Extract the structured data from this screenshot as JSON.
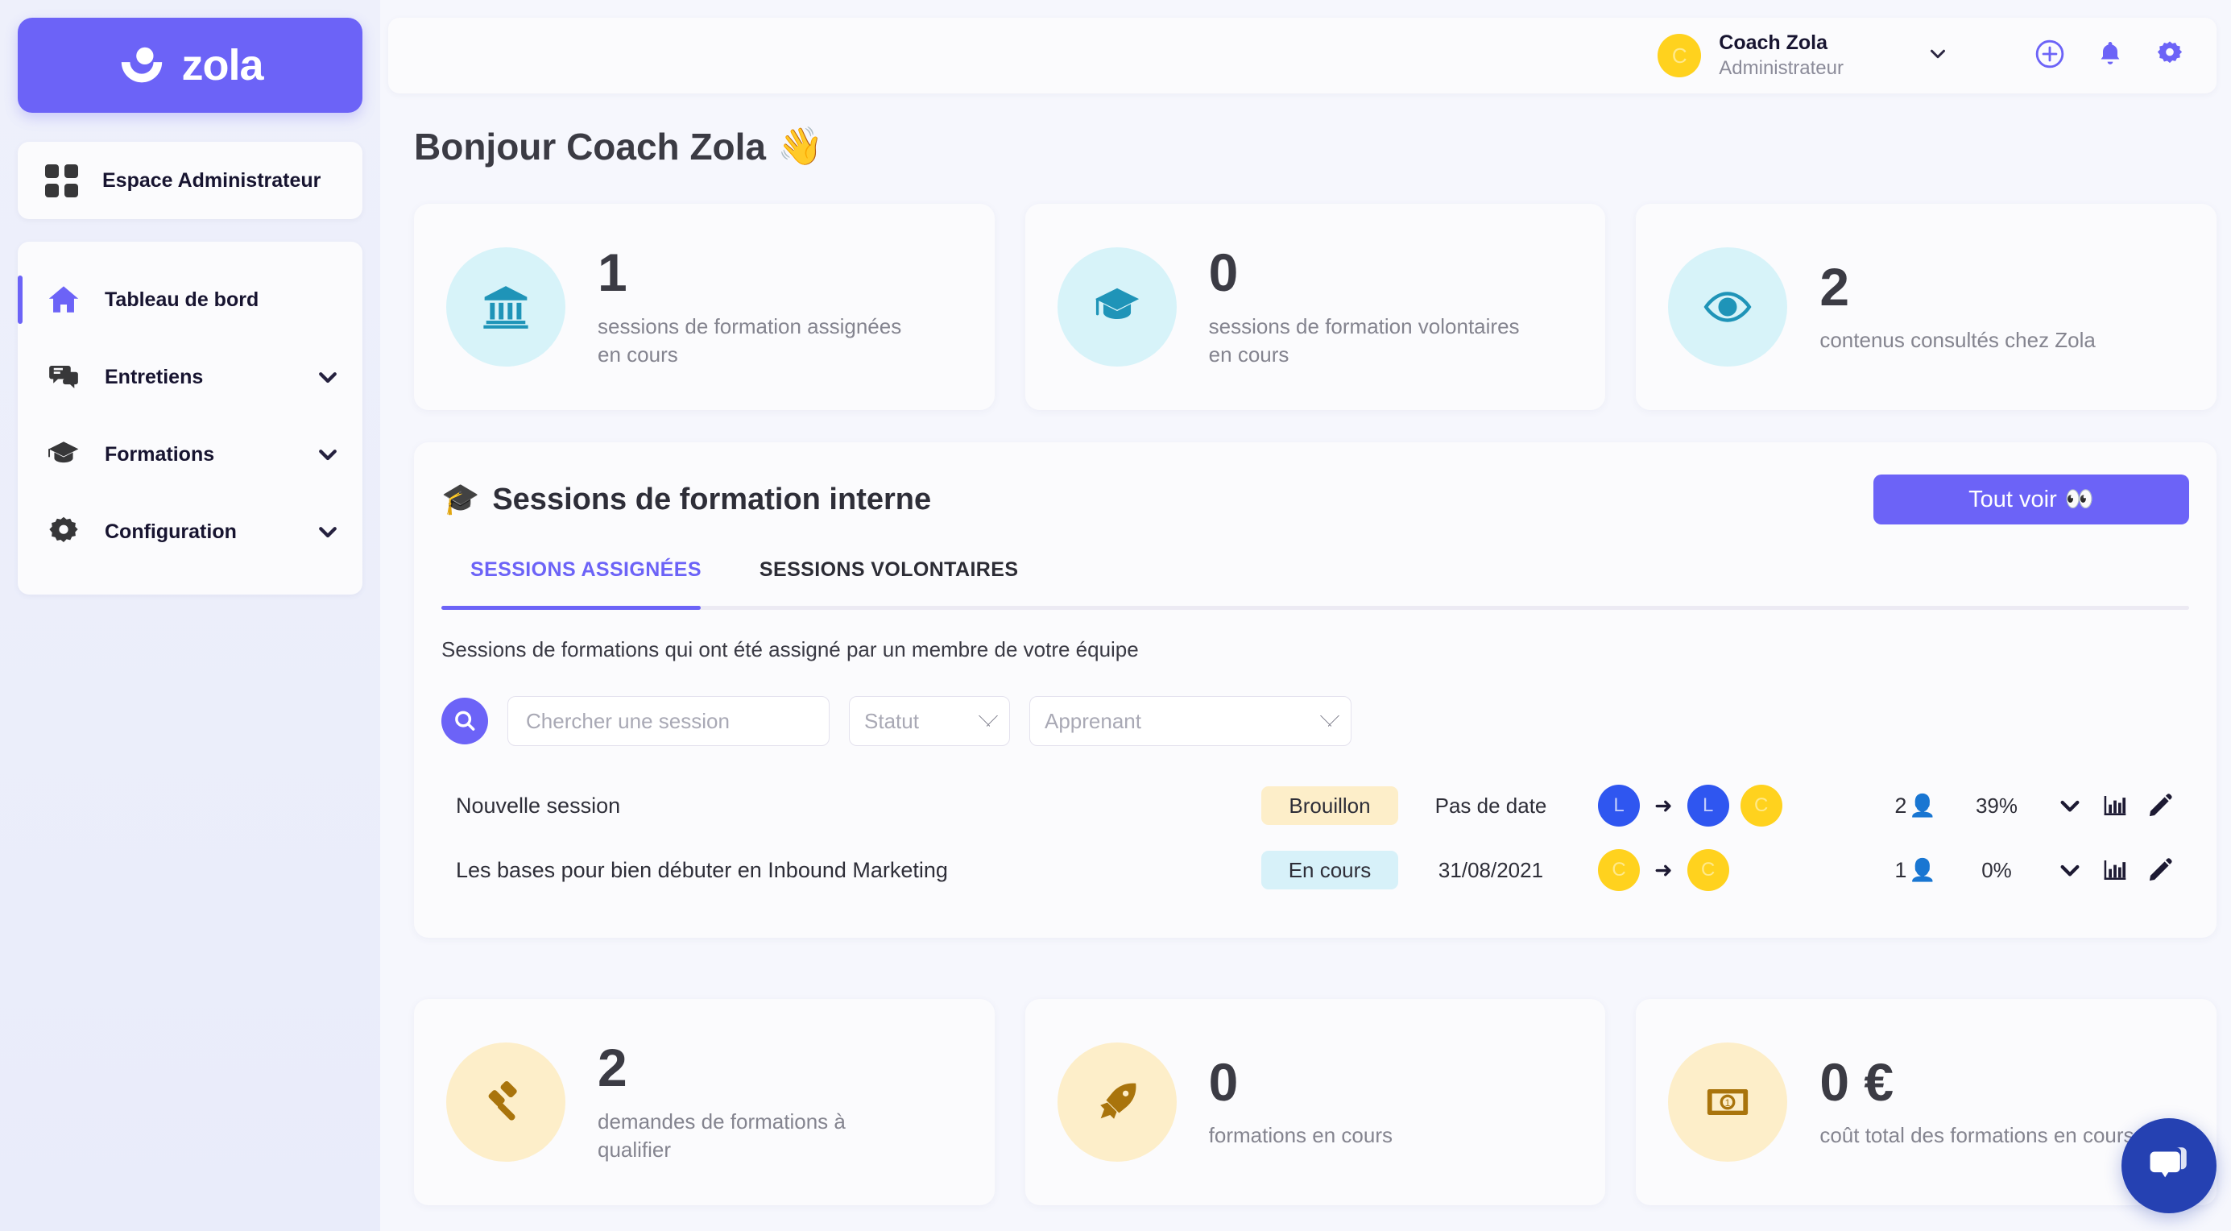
{
  "brand": {
    "name": "zola",
    "accent": "#6c63f7"
  },
  "sidebar": {
    "admin_space": {
      "label": "Espace Administrateur",
      "icon": "grid-icon"
    },
    "items": [
      {
        "label": "Tableau de bord",
        "icon": "home-icon",
        "active": true,
        "expandable": false
      },
      {
        "label": "Entretiens",
        "icon": "chat-bubbles-icon",
        "active": false,
        "expandable": true
      },
      {
        "label": "Formations",
        "icon": "graduation-cap-icon",
        "active": false,
        "expandable": true
      },
      {
        "label": "Configuration",
        "icon": "gear-icon",
        "active": false,
        "expandable": true
      }
    ]
  },
  "topbar": {
    "avatar_initial": "C",
    "user_name": "Coach Zola",
    "user_role": "Administrateur",
    "icons": [
      "plus-circle-icon",
      "bell-icon",
      "gear-icon"
    ]
  },
  "page": {
    "greeting": "Bonjour Coach Zola",
    "greeting_emoji": "👋"
  },
  "top_stats": [
    {
      "value": "1",
      "label": "sessions de formation assignées en cours",
      "icon": "bank-icon",
      "tone": "blue"
    },
    {
      "value": "0",
      "label": "sessions de formation volontaires en cours",
      "icon": "graduation-cap-icon",
      "tone": "blue"
    },
    {
      "value": "2",
      "label": "contenus consultés chez Zola",
      "icon": "eye-icon",
      "tone": "blue"
    }
  ],
  "sessions_panel": {
    "title": "Sessions de formation interne",
    "title_emoji": "🎓",
    "see_all_label": "Tout voir",
    "see_all_emoji": "👀",
    "tabs": [
      {
        "label": "SESSIONS ASSIGNÉES",
        "active": true
      },
      {
        "label": "SESSIONS VOLONTAIRES",
        "active": false
      }
    ],
    "subtitle": "Sessions de formations qui ont été assigné par un membre de votre équipe",
    "filters": {
      "search_placeholder": "Chercher une session",
      "search_value": "",
      "statut_placeholder": "Statut",
      "apprenant_placeholder": "Apprenant"
    },
    "rows": [
      {
        "title": "Nouvelle session",
        "status": "Brouillon",
        "status_tone": "draft",
        "date": "Pas de date",
        "from": [
          {
            "initial": "L",
            "tone": "blue"
          }
        ],
        "to": [
          {
            "initial": "L",
            "tone": "blue"
          },
          {
            "initial": "C",
            "tone": "yellow"
          }
        ],
        "learners": "2",
        "learner_emoji": "👤",
        "progress": "39%"
      },
      {
        "title": "Les bases pour bien débuter en Inbound Marketing",
        "status": "En cours",
        "status_tone": "progress",
        "date": "31/08/2021",
        "from": [
          {
            "initial": "C",
            "tone": "yellow"
          }
        ],
        "to": [
          {
            "initial": "C",
            "tone": "yellow"
          }
        ],
        "learners": "1",
        "learner_emoji": "👤",
        "progress": "0%"
      }
    ],
    "row_action_icons": [
      "chevron-down-icon",
      "bar-chart-icon",
      "pencil-icon"
    ]
  },
  "bottom_stats": [
    {
      "value": "2",
      "label": "demandes de formations à qualifier",
      "icon": "gavel-icon",
      "tone": "amber"
    },
    {
      "value": "0",
      "label": "formations en cours",
      "icon": "rocket-icon",
      "tone": "amber"
    },
    {
      "value": "0 €",
      "label": "coût total des formations en cours",
      "icon": "banknote-icon",
      "tone": "amber"
    }
  ],
  "chat_widget": {
    "icon": "chat-icon"
  }
}
